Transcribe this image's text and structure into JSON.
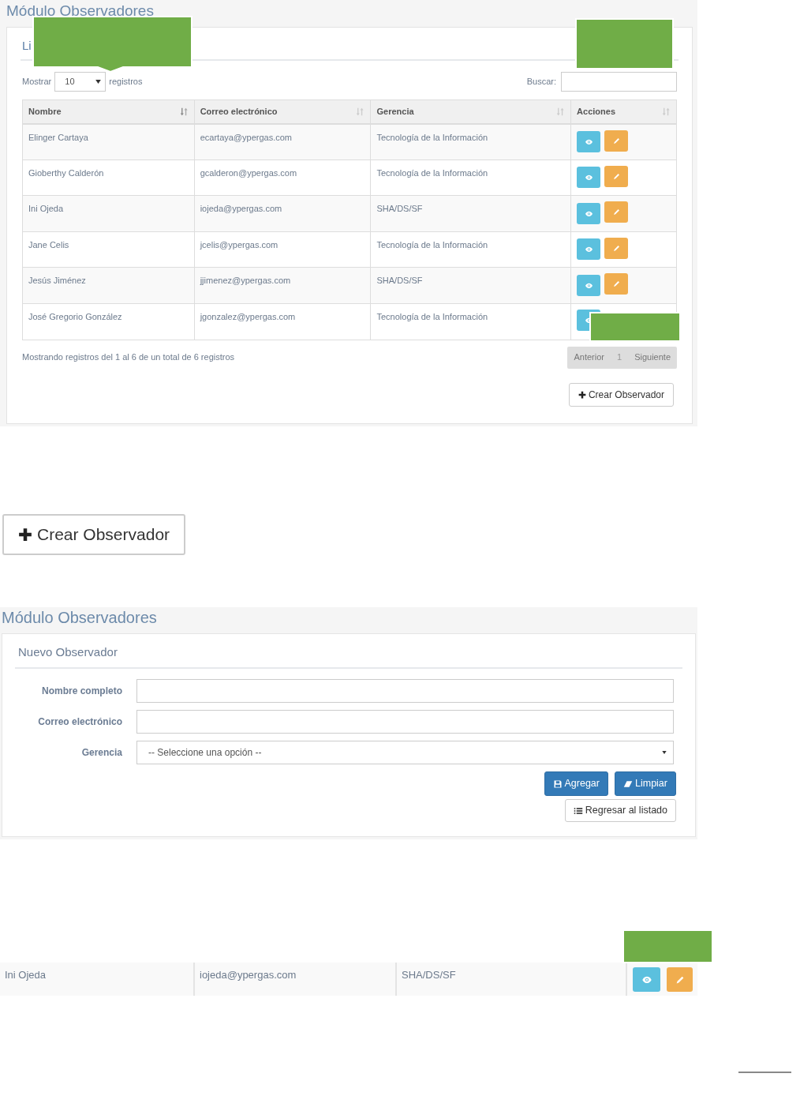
{
  "list_view": {
    "header_title": "Módulo Observadores",
    "panel_title": "Li",
    "length": {
      "label_before": "Mostrar",
      "value": "10",
      "label_after": "registros"
    },
    "search": {
      "label": "Buscar:"
    },
    "table": {
      "columns": [
        {
          "label": "Nombre",
          "sorted": true
        },
        {
          "label": "Correo electrónico",
          "sorted": false
        },
        {
          "label": "Gerencia",
          "sorted": false
        },
        {
          "label": "Acciones",
          "sorted": false
        }
      ],
      "rows": [
        {
          "nombre": "Elinger Cartaya",
          "correo": "ecartaya@ypergas.com",
          "gerencia": "Tecnología de la Información",
          "edit_visible": true
        },
        {
          "nombre": "Gioberthy Calderón",
          "correo": "gcalderon@ypergas.com",
          "gerencia": "Tecnología de la Información",
          "edit_visible": true
        },
        {
          "nombre": "Ini Ojeda",
          "correo": "iojeda@ypergas.com",
          "gerencia": "SHA/DS/SF",
          "edit_visible": true
        },
        {
          "nombre": "Jane Celis",
          "correo": "jcelis@ypergas.com",
          "gerencia": "Tecnología de la Información",
          "edit_visible": true
        },
        {
          "nombre": "Jesús Jiménez",
          "correo": "jjimenez@ypergas.com",
          "gerencia": "SHA/DS/SF",
          "edit_visible": true
        },
        {
          "nombre": "José Gregorio González",
          "correo": "jgonzalez@ypergas.com",
          "gerencia": "Tecnología de la Información",
          "edit_visible": false
        }
      ]
    },
    "info": "Mostrando registros del 1 al 6 de un total de 6 registros",
    "pagination": [
      {
        "label": "Anterior",
        "selected": false
      },
      {
        "label": "1",
        "selected": true
      },
      {
        "label": "Siguiente",
        "selected": false
      }
    ],
    "create_button": "Crear Observador"
  },
  "create_button_large": "Crear Observador",
  "form_view": {
    "header_title": "Módulo Observadores",
    "panel_title": "Nuevo Observador",
    "fields": [
      {
        "label": "Nombre completo",
        "kind": "text"
      },
      {
        "label": "Correo electrónico",
        "kind": "text"
      },
      {
        "label": "Gerencia",
        "kind": "select",
        "value": "-- Seleccione una opción --"
      }
    ],
    "buttons": [
      {
        "label": "Agregar",
        "kind": "save"
      },
      {
        "label": "Limpiar",
        "kind": "clear"
      }
    ],
    "back_button": "Regresar al listado"
  },
  "detail_row": {
    "nombre": "Ini Ojeda",
    "correo": "iojeda@ypergas.com",
    "gerencia": "SHA/DS/SF"
  }
}
